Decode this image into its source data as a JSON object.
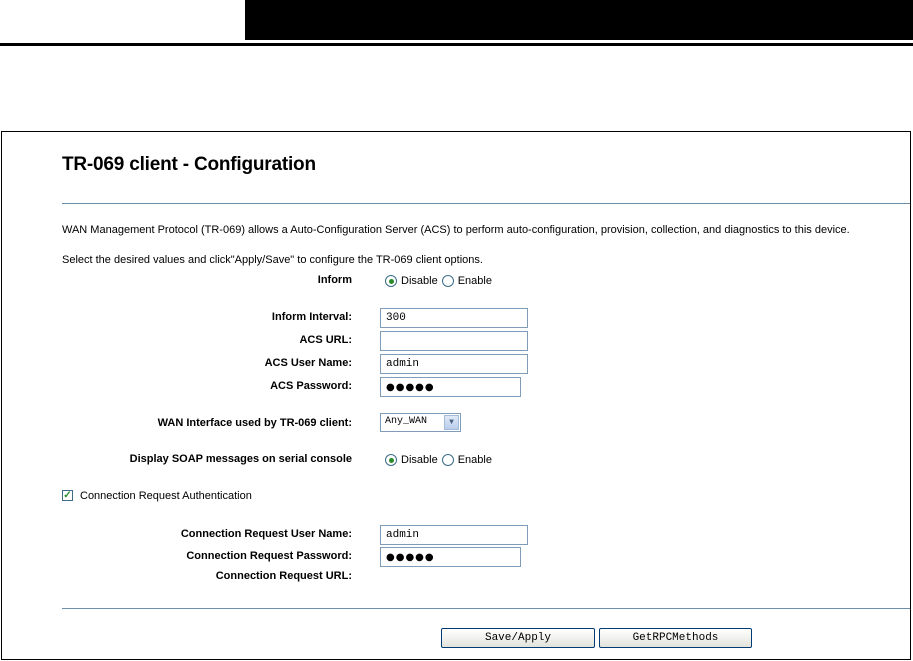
{
  "page": {
    "title": "TR-069 client - Configuration",
    "description": "WAN Management Protocol (TR-069) allows a Auto-Configuration Server (ACS) to perform auto-configuration, provision, collection, and diagnostics to this device.",
    "instruction": "Select the desired values and click\"Apply/Save\" to configure the TR-069 client options."
  },
  "inform": {
    "label": "Inform",
    "options": [
      "Disable",
      "Enable"
    ],
    "selected": "Disable"
  },
  "fields": {
    "inform_interval": {
      "label": "Inform Interval:",
      "value": "300"
    },
    "acs_url": {
      "label": "ACS URL:",
      "value": ""
    },
    "acs_user_name": {
      "label": "ACS User Name:",
      "value": "admin"
    },
    "acs_password": {
      "label": "ACS Password:",
      "value": "●●●●●"
    }
  },
  "wan_interface": {
    "label": "WAN Interface used by TR-069 client:",
    "selected": "Any_WAN"
  },
  "soap": {
    "label": "Display SOAP messages on serial console",
    "options": [
      "Disable",
      "Enable"
    ],
    "selected": "Disable"
  },
  "conn_auth": {
    "label": "Connection Request Authentication",
    "checked": true
  },
  "conn_fields": {
    "user_name": {
      "label": "Connection Request User Name:",
      "value": "admin"
    },
    "password": {
      "label": "Connection Request Password:",
      "value": "●●●●●"
    },
    "url": {
      "label": "Connection Request URL:",
      "value": ""
    }
  },
  "buttons": {
    "save_apply": "Save/Apply",
    "get_rpc_methods": "GetRPCMethods"
  },
  "colors": {
    "rule": "#6f8fa8",
    "input_border": "#7f9db9",
    "radio_dot": "#2a8a2a"
  }
}
